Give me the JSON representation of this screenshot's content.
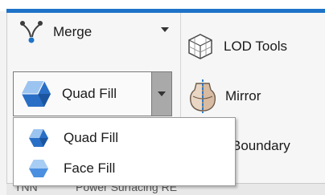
{
  "ribbon": {
    "merge": {
      "label": "Merge",
      "icon": "merge-icon"
    },
    "quad_fill": {
      "label": "Quad Fill",
      "icon": "quad-fill-icon"
    },
    "lod_tools": {
      "label": "LOD Tools",
      "icon": "lod-tools-icon"
    },
    "mirror": {
      "label": "Mirror",
      "icon": "mirror-icon"
    },
    "boundary": {
      "label": "Boundary"
    }
  },
  "dropdown": {
    "items": [
      {
        "label": "Quad Fill",
        "icon": "quad-fill-icon"
      },
      {
        "label": "Face Fill",
        "icon": "face-fill-icon"
      }
    ]
  },
  "bottom": {
    "tab_a": "TNN",
    "tab_b": "Power Surfacing RE"
  },
  "colors": {
    "accent_line": "#1e73c8",
    "hex_blue_light": "#9cc4f0",
    "hex_blue_dark": "#2a6fc6",
    "dropdown_arrow_bg": "#a9a9a9"
  }
}
